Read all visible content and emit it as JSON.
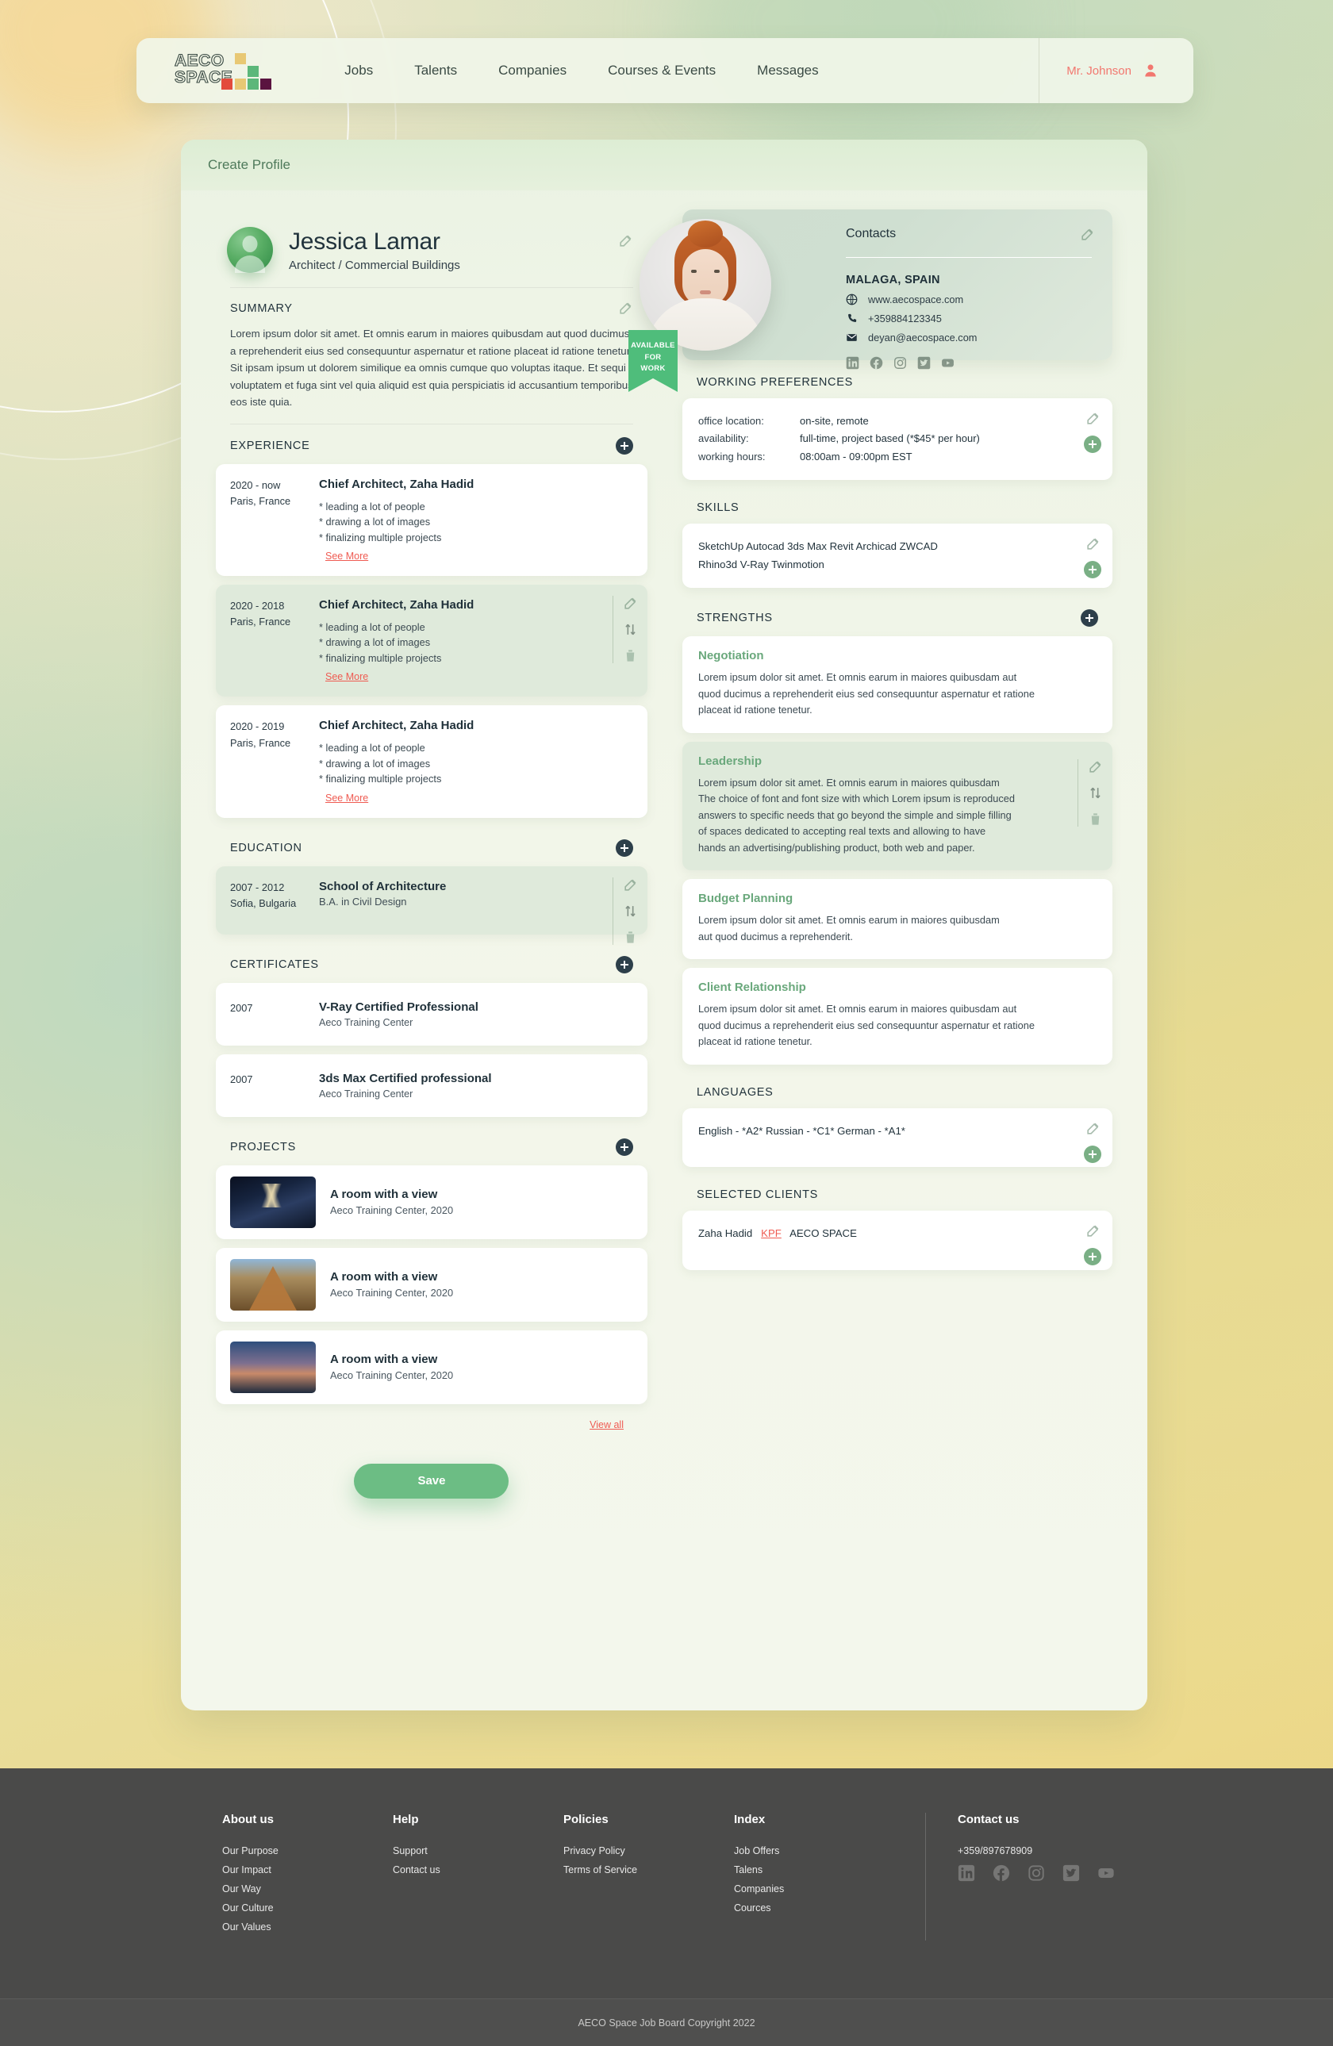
{
  "header": {
    "logo_line1": "AECO",
    "logo_line2": "SPACE",
    "nav": [
      {
        "label": "Jobs"
      },
      {
        "label": "Talents"
      },
      {
        "label": "Companies"
      },
      {
        "label": "Courses & Events"
      },
      {
        "label": "Messages"
      }
    ],
    "user_name": "Mr. Johnson"
  },
  "page": {
    "title": "Create Profile",
    "save_label": "Save",
    "view_all_label": "View all"
  },
  "profile": {
    "name": "Jessica Lamar",
    "role": "Architect / Commercial Buildings"
  },
  "summary": {
    "heading": "SUMMARY",
    "text": "Lorem ipsum dolor sit amet. Et omnis earum in maiores quibusdam aut quod ducimus a reprehenderit eius sed consequuntur aspernatur et ratione placeat id ratione tenetur. Sit ipsam ipsum ut dolorem similique ea omnis cumque quo voluptas itaque. Et sequi voluptatem et fuga sint vel quia aliquid est quia perspiciatis id accusantium temporibus eos iste quia."
  },
  "experience": {
    "heading": "EXPERIENCE",
    "see_more_label": "See More",
    "items": [
      {
        "period": "2020 - now",
        "location": "Paris, France",
        "title": "Chief Architect, Zaha Hadid",
        "bullets": [
          "* leading a lot of people",
          "* drawing a lot of images",
          "* finalizing multiple projects"
        ],
        "active": false
      },
      {
        "period": "2020 - 2018",
        "location": "Paris, France",
        "title": "Chief Architect, Zaha Hadid",
        "bullets": [
          "* leading a lot of people",
          "* drawing a lot of images",
          "* finalizing multiple projects"
        ],
        "active": true
      },
      {
        "period": "2020 - 2019",
        "location": "Paris, France",
        "title": "Chief Architect, Zaha Hadid",
        "bullets": [
          "* leading a lot of people",
          "* drawing a lot of images",
          "* finalizing multiple projects"
        ],
        "active": false
      }
    ]
  },
  "education": {
    "heading": "EDUCATION",
    "items": [
      {
        "period": "2007 - 2012",
        "location": "Sofia, Bulgaria",
        "title": "School of Architecture",
        "subtitle": "B.A. in Civil Design",
        "active": true
      }
    ]
  },
  "certificates": {
    "heading": "CERTIFICATES",
    "items": [
      {
        "year": "2007",
        "title": "V-Ray Certified Professional",
        "issuer": "Aeco Training Center"
      },
      {
        "year": "2007",
        "title": "3ds Max Certified professional",
        "issuer": "Aeco Training Center"
      }
    ]
  },
  "projects": {
    "heading": "PROJECTS",
    "items": [
      {
        "title": "A room with a view",
        "subtitle": "Aeco Training Center, 2020"
      },
      {
        "title": "A room with a view",
        "subtitle": "Aeco Training Center, 2020"
      },
      {
        "title": "A room with a view",
        "subtitle": "Aeco Training Center, 2020"
      }
    ]
  },
  "contacts": {
    "title": "Contacts",
    "city": "MALAGA, SPAIN",
    "website": "www.aecospace.com",
    "phone": "+359884123345",
    "email": "deyan@aecospace.com",
    "ribbon_line1": "AVAILABLE",
    "ribbon_line2": "FOR",
    "ribbon_line3": "WORK",
    "socials": [
      "linkedin-icon",
      "facebook-icon",
      "instagram-icon",
      "twitter-icon",
      "youtube-icon"
    ]
  },
  "working_preferences": {
    "heading": "WORKING PREFERENCES",
    "rows": [
      {
        "key": "office location:",
        "value": "on-site, remote"
      },
      {
        "key": "availability:",
        "value": "full-time, project based (*$45* per hour)"
      },
      {
        "key": "working hours:",
        "value": "08:00am - 09:00pm EST"
      }
    ]
  },
  "skills": {
    "heading": "SKILLS",
    "line1": "SketchUp   Autocad   3ds Max   Revit   Archicad   ZWCAD",
    "line2": "Rhino3d   V-Ray   Twinmotion"
  },
  "strengths": {
    "heading": "STRENGTHS",
    "items": [
      {
        "title": "Negotiation",
        "text": "Lorem ipsum dolor sit amet. Et omnis earum in maiores quibusdam aut quod ducimus a reprehenderit eius sed consequuntur aspernatur et ratione placeat id ratione tenetur.",
        "active": false
      },
      {
        "title": "Leadership",
        "text": "Lorem ipsum dolor sit amet. Et omnis earum in maiores quibusdam The choice of font and font size with which Lorem ipsum is reproduced answers to specific needs that go beyond the simple and simple filling of spaces dedicated to accepting real texts and allowing to have hands an advertising/publishing product, both web and paper.",
        "active": true
      },
      {
        "title": "Budget Planning",
        "text": "Lorem ipsum dolor sit amet. Et omnis earum in maiores quibusdam aut quod ducimus a reprehenderit.",
        "active": false
      },
      {
        "title": "Client Relationship",
        "text": "Lorem ipsum dolor sit amet. Et omnis earum in maiores quibusdam aut quod ducimus a reprehenderit eius sed consequuntur aspernatur et ratione placeat id ratione tenetur.",
        "active": false
      }
    ]
  },
  "languages": {
    "heading": "LANGUAGES",
    "value": "English - *A2*   Russian - *C1*   German - *A1*"
  },
  "selected_clients": {
    "heading": "SELECTED CLIENTS",
    "before": "Zaha Hadid",
    "highlight": "KPF",
    "after": "AECO SPACE"
  },
  "footer": {
    "columns": [
      {
        "title": "About us",
        "links": [
          "Our Purpose",
          "Our Impact",
          "Our Way",
          "Our Culture",
          "Our Values"
        ]
      },
      {
        "title": "Help",
        "links": [
          "Support",
          "Contact us"
        ]
      },
      {
        "title": "Policies",
        "links": [
          "Privacy Policy",
          "Terms of Service"
        ]
      },
      {
        "title": "Index",
        "links": [
          "Job Offers",
          "Talens",
          "Companies",
          "Cources"
        ]
      }
    ],
    "contact_title": "Contact us",
    "phone": "+359/897678909",
    "socials": [
      "linkedin-icon",
      "facebook-icon",
      "instagram-icon",
      "twitter-icon",
      "youtube-icon"
    ],
    "copyright": "AECO Space Job Board Copyright 2022"
  },
  "colors": {
    "accent_green": "#6cbd84",
    "accent_red": "#ef5b52",
    "dark": "#22333c",
    "footer_bg": "#4a4a49",
    "phone_yellow": "#e4c65f"
  }
}
